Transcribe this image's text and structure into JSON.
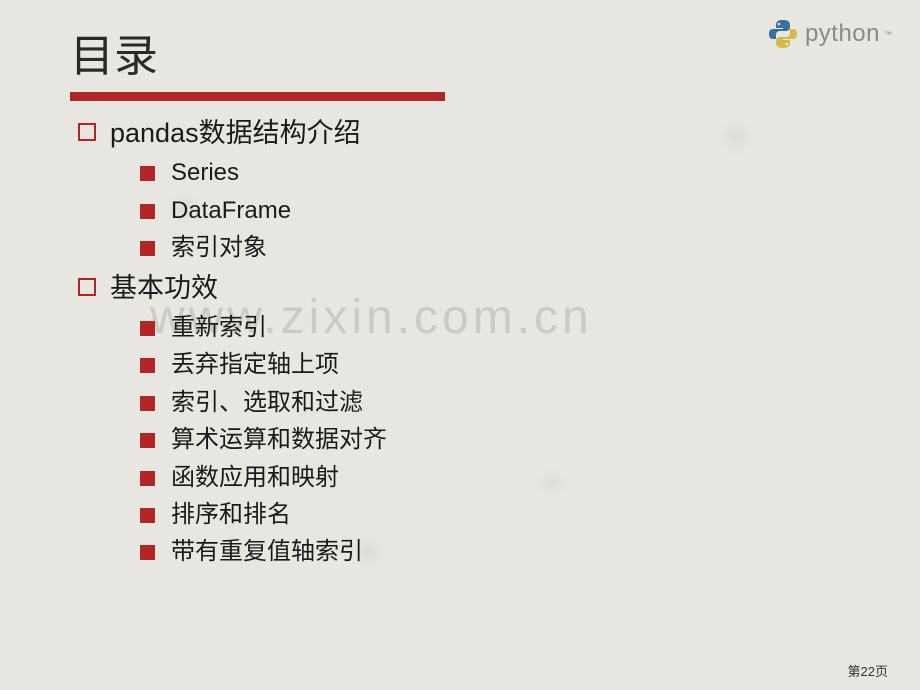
{
  "title": "目录",
  "logo": {
    "text": "python",
    "tm": "™"
  },
  "watermark": "www.zixin.com.cn",
  "outline": [
    {
      "label": "pandas数据结构介绍",
      "children": [
        {
          "label": "Series"
        },
        {
          "label": "DataFrame"
        },
        {
          "label": "索引对象"
        }
      ]
    },
    {
      "label": "基本功效",
      "children": [
        {
          "label": "重新索引"
        },
        {
          "label": "丢弃指定轴上项"
        },
        {
          "label": "索引、选取和过滤"
        },
        {
          "label": "算术运算和数据对齐"
        },
        {
          "label": "函数应用和映射"
        },
        {
          "label": "排序和排名"
        },
        {
          "label": "带有重复值轴索引"
        }
      ]
    }
  ],
  "pageNumber": "第22页"
}
